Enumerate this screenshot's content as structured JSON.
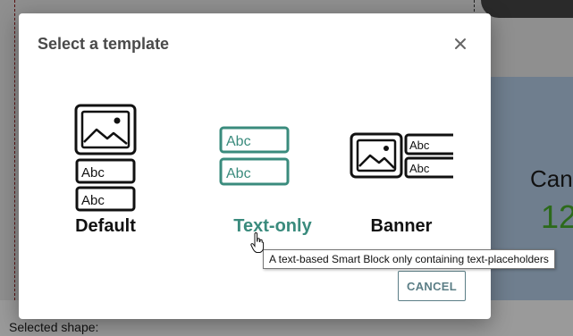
{
  "dialog": {
    "title": "Select a template",
    "templates": [
      {
        "label": "Default",
        "icon": "default-template-icon",
        "selected": false
      },
      {
        "label": "Text-only",
        "icon": "text-only-template-icon",
        "selected": true
      },
      {
        "label": "Banner",
        "icon": "banner-template-icon",
        "selected": false
      }
    ],
    "placeholder_text": "Abc",
    "tooltip": "A text-based Smart Block only containing text-placeholders",
    "cancel_label": "CANCEL",
    "accent_color": "#3a8b7d",
    "cancel_color": "#5b7e86"
  },
  "background": {
    "selected_shape_label": "Selected shape:",
    "right_panel_label": "Canc",
    "right_panel_value": "12"
  }
}
